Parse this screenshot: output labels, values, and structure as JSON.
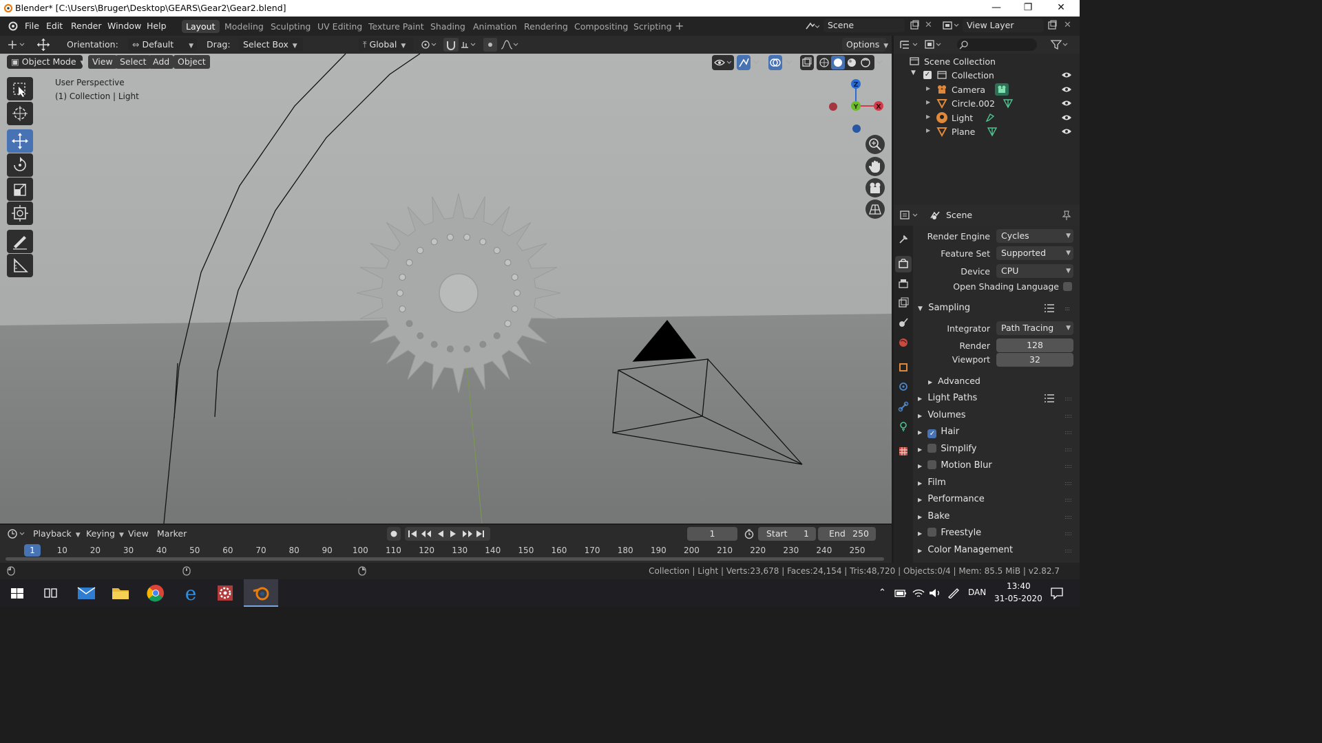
{
  "window": {
    "title": "Blender* [C:\\Users\\Bruger\\Desktop\\GEARS\\Gear2\\Gear2.blend]"
  },
  "menu": [
    "File",
    "Edit",
    "Render",
    "Window",
    "Help"
  ],
  "workspaces": [
    "Layout",
    "Modeling",
    "Sculpting",
    "UV Editing",
    "Texture Paint",
    "Shading",
    "Animation",
    "Rendering",
    "Compositing",
    "Scripting"
  ],
  "active_workspace": "Layout",
  "top_right": {
    "scene": "Scene",
    "view_layer": "View Layer"
  },
  "tool_header": {
    "orientation_label": "Orientation:",
    "orientation_value": "Default",
    "drag_label": "Drag:",
    "drag_value": "Select Box",
    "transform_orientation": "Global",
    "options": "Options"
  },
  "viewport_header": {
    "mode": "Object Mode",
    "menus": [
      "View",
      "Select",
      "Add",
      "Object"
    ]
  },
  "viewport": {
    "view_name": "User Perspective",
    "context": "(1) Collection | Light"
  },
  "gizmo_axes": [
    "Z",
    "Y",
    "X"
  ],
  "outliner": {
    "root": "Scene Collection",
    "collection": "Collection",
    "items": [
      "Camera",
      "Circle.002",
      "Light",
      "Plane"
    ]
  },
  "properties": {
    "header": "Scene",
    "render_engine_label": "Render Engine",
    "render_engine": "Cycles",
    "feature_set_label": "Feature Set",
    "feature_set": "Supported",
    "device_label": "Device",
    "device": "CPU",
    "osl_label": "Open Shading Language",
    "sampling": "Sampling",
    "integrator_label": "Integrator",
    "integrator": "Path Tracing",
    "render_label": "Render",
    "render_samples": "128",
    "viewport_label": "Viewport",
    "viewport_samples": "32",
    "advanced": "Advanced",
    "panels": [
      "Light Paths",
      "Volumes",
      "Hair",
      "Simplify",
      "Motion Blur",
      "Film",
      "Performance",
      "Bake",
      "Freestyle",
      "Color Management"
    ]
  },
  "timeline": {
    "menus": [
      "Playback",
      "Keying",
      "View",
      "Marker"
    ],
    "current_frame": "1",
    "start_label": "Start",
    "start": "1",
    "end_label": "End",
    "end": "250",
    "ruler": [
      "1",
      "10",
      "20",
      "30",
      "40",
      "50",
      "60",
      "70",
      "80",
      "90",
      "100",
      "110",
      "120",
      "130",
      "140",
      "150",
      "160",
      "170",
      "180",
      "190",
      "200",
      "210",
      "220",
      "230",
      "240",
      "250"
    ]
  },
  "status": "Collection | Light | Verts:23,678 | Faces:24,154 | Tris:48,720 | Objects:0/4 | Mem: 85.5 MiB | v2.82.7",
  "taskbar": {
    "lang": "DAN",
    "time": "13:40",
    "date": "31-05-2020"
  }
}
